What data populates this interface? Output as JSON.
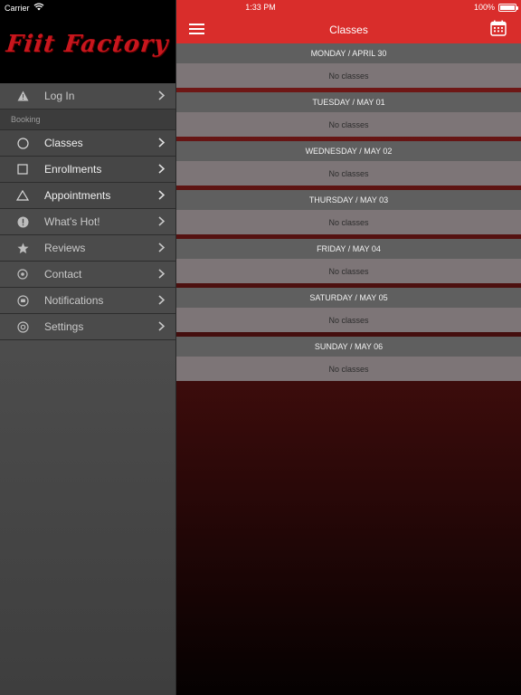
{
  "status_bar": {
    "carrier": "Carrier",
    "time": "1:33 PM",
    "battery": "100%"
  },
  "sidebar": {
    "logo": "Fiit Factory",
    "items": [
      {
        "label": "Log In",
        "icon": "warning-icon"
      },
      {
        "label": "Classes",
        "icon": "circle-icon"
      },
      {
        "label": "Enrollments",
        "icon": "square-icon"
      },
      {
        "label": "Appointments",
        "icon": "triangle-icon"
      },
      {
        "label": "What's Hot!",
        "icon": "alert-icon"
      },
      {
        "label": "Reviews",
        "icon": "star-icon"
      },
      {
        "label": "Contact",
        "icon": "location-pin-icon"
      },
      {
        "label": "Notifications",
        "icon": "chat-bubble-icon"
      },
      {
        "label": "Settings",
        "icon": "gear-icon"
      }
    ],
    "section_label": "Booking"
  },
  "header": {
    "title": "Classes"
  },
  "days": [
    {
      "label": "MONDAY / APRIL 30",
      "message": "No classes"
    },
    {
      "label": "TUESDAY / MAY 01",
      "message": "No classes"
    },
    {
      "label": "WEDNESDAY / MAY 02",
      "message": "No classes"
    },
    {
      "label": "THURSDAY / MAY 03",
      "message": "No classes"
    },
    {
      "label": "FRIDAY / MAY 04",
      "message": "No classes"
    },
    {
      "label": "SATURDAY / MAY 05",
      "message": "No classes"
    },
    {
      "label": "SUNDAY / MAY 06",
      "message": "No classes"
    }
  ],
  "colors": {
    "accent": "#d92d2b",
    "brand": "#c8161d"
  }
}
